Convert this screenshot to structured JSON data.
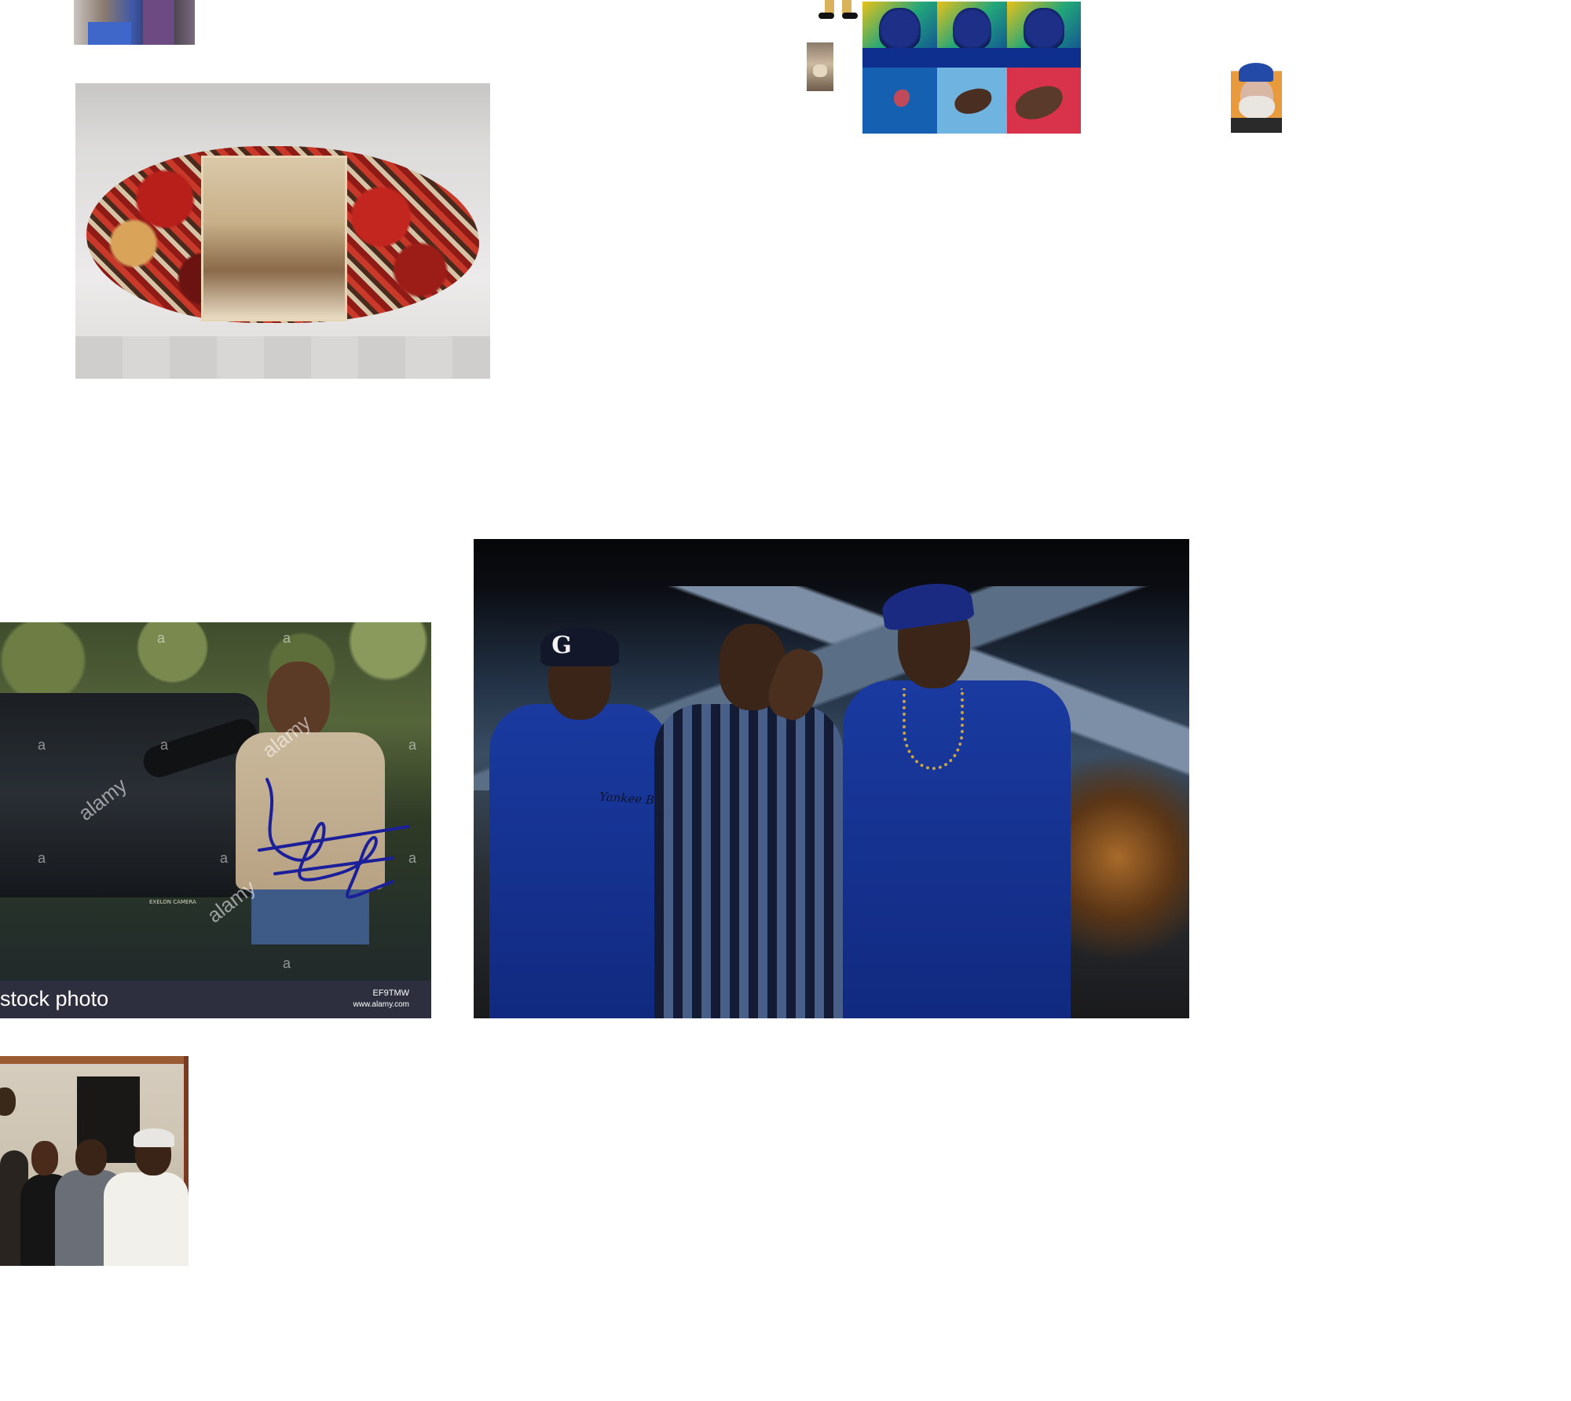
{
  "page": {
    "background": "#ffffff"
  },
  "images": {
    "couple": {
      "label": ""
    },
    "collage": {
      "label": ""
    },
    "legs": {
      "label": ""
    },
    "tiny_portrait": {
      "label": ""
    },
    "popart": {
      "label": ""
    },
    "old_man": {
      "label": ""
    },
    "director": {
      "watermark": "alamy",
      "watermark_letter": "a",
      "caption": "stock photo",
      "image_id": "EF9TMW",
      "url": "www.alamy.com",
      "camera_label": "EXELON CAMERA"
    },
    "three_men": {
      "cap_letter": "G",
      "shirt_text": "Yankee Baby"
    },
    "group_photo": {
      "label": ""
    }
  },
  "colors": {
    "popart_top": "#0e3f9a",
    "popart_bottom": [
      "#1560b0",
      "#6fb4e0",
      "#d8334a"
    ],
    "shirt_blue": "#1a3aa0",
    "footer_bar": "#2e2f3e",
    "signature_ink": "#1c1f9a"
  }
}
